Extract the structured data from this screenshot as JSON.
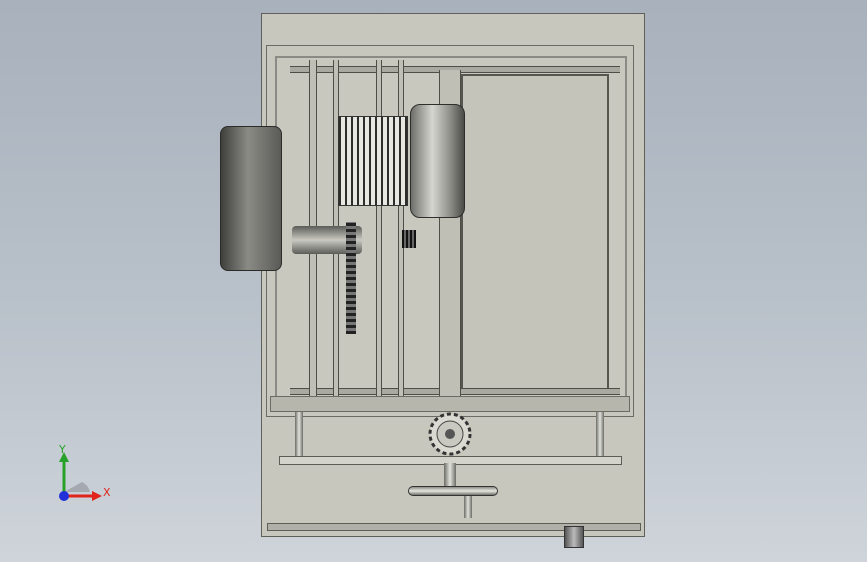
{
  "viewport": {
    "colors": {
      "background_top": "#a8b1bc",
      "background_bottom": "#cfd4da",
      "cabinet": "#c8c7bd",
      "x_axis": "#e0241b",
      "y_axis": "#27a12a",
      "z_origin": "#2130d9"
    }
  },
  "triad": {
    "x_label": "X",
    "y_label": "Y"
  }
}
